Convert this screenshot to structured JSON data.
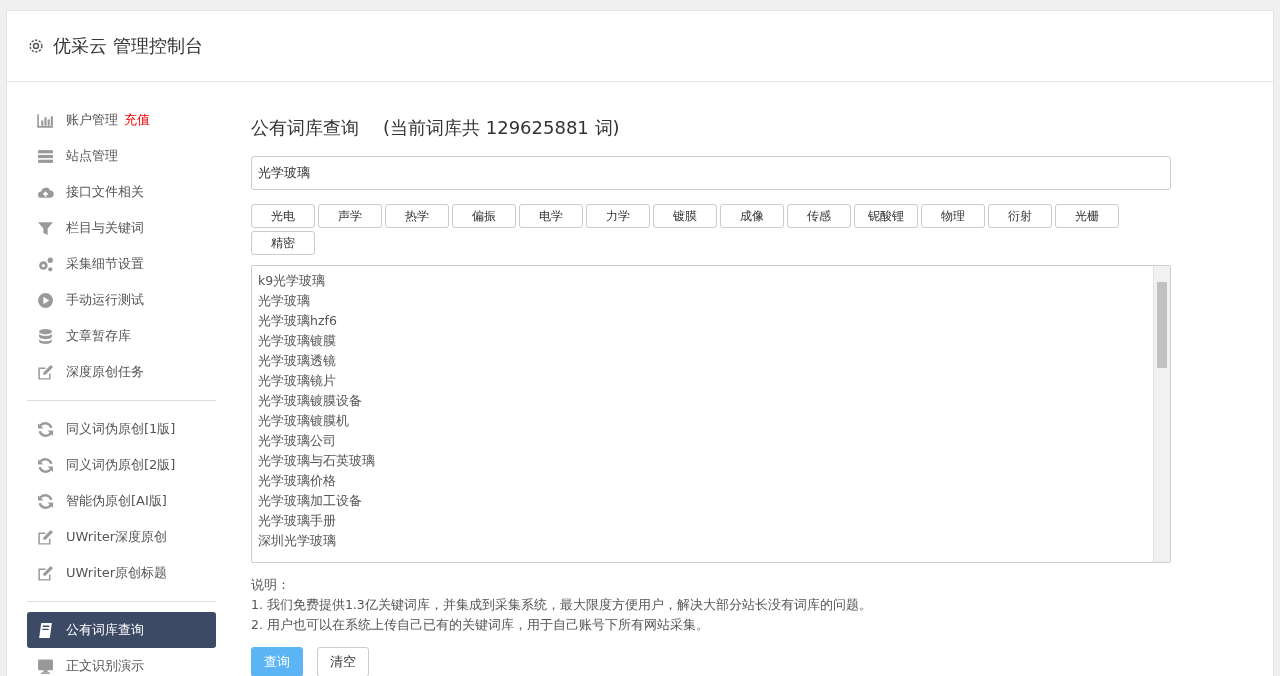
{
  "header": {
    "title": "优采云 管理控制台"
  },
  "sidebar": {
    "groups": [
      {
        "items": [
          {
            "label": "账户管理",
            "badge": "充值",
            "kind": "chart",
            "selected": false
          },
          {
            "label": "站点管理",
            "kind": "server",
            "selected": false
          },
          {
            "label": "接口文件相关",
            "kind": "cloud",
            "selected": false
          },
          {
            "label": "栏目与关键词",
            "kind": "filter",
            "selected": false
          },
          {
            "label": "采集细节设置",
            "kind": "gears",
            "selected": false
          },
          {
            "label": "手动运行测试",
            "kind": "play",
            "selected": false
          },
          {
            "label": "文章暂存库",
            "kind": "database",
            "selected": false
          },
          {
            "label": "深度原创任务",
            "kind": "edit",
            "selected": false
          }
        ]
      },
      {
        "items": [
          {
            "label": "同义词伪原创[1版]",
            "kind": "sync",
            "selected": false
          },
          {
            "label": "同义词伪原创[2版]",
            "kind": "sync",
            "selected": false
          },
          {
            "label": "智能伪原创[AI版]",
            "kind": "sync",
            "selected": false
          },
          {
            "label": "UWriter深度原创",
            "kind": "edit",
            "selected": false
          },
          {
            "label": "UWriter原创标题",
            "kind": "edit",
            "selected": false
          }
        ]
      },
      {
        "items": [
          {
            "label": "公有词库查询",
            "kind": "book",
            "selected": true
          },
          {
            "label": "正文识别演示",
            "kind": "monitor",
            "selected": false
          }
        ]
      }
    ]
  },
  "main": {
    "title": "公有词库查询",
    "count": "(当前词库共 129625881 词)",
    "search": {
      "value": "光学玻璃"
    },
    "tags": [
      "光电",
      "声学",
      "热学",
      "偏振",
      "电学",
      "力学",
      "镀膜",
      "成像",
      "传感",
      "铌酸锂",
      "物理",
      "衍射",
      "光栅",
      "精密"
    ],
    "results": [
      "k9光学玻璃",
      "光学玻璃",
      "光学玻璃hzf6",
      "光学玻璃镀膜",
      "光学玻璃透镜",
      "光学玻璃镜片",
      "光学玻璃镀膜设备",
      "光学玻璃镀膜机",
      "光学玻璃公司",
      "光学玻璃与石英玻璃",
      "光学玻璃价格",
      "光学玻璃加工设备",
      "光学玻璃手册",
      "深圳光学玻璃"
    ],
    "notes_title": "说明：",
    "notes": [
      "1. 我们免费提供1.3亿关键词库，并集成到采集系统，最大限度方便用户，解决大部分站长没有词库的问题。",
      "2. 用户也可以在系统上传自己已有的关键词库，用于自己账号下所有网站采集。"
    ],
    "buttons": [
      {
        "label": "查询",
        "kind": "primary"
      },
      {
        "label": "清空",
        "kind": "default"
      }
    ]
  }
}
